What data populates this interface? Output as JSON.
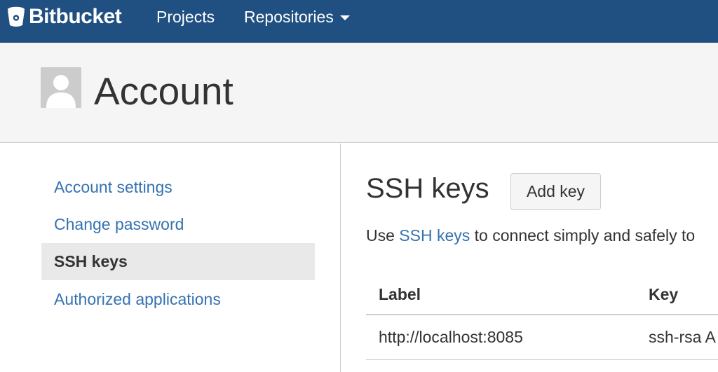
{
  "topbar": {
    "brand": "Bitbucket",
    "brand_icon": "bitbucket-bucket-icon",
    "nav": [
      {
        "label": "Projects"
      },
      {
        "label": "Repositories",
        "has_dropdown": true
      }
    ],
    "background_color": "#205081"
  },
  "header": {
    "title": "Account",
    "avatar_icon": "user-avatar-icon"
  },
  "sidebar": {
    "items": [
      {
        "label": "Account settings",
        "active": false
      },
      {
        "label": "Change password",
        "active": false
      },
      {
        "label": "SSH keys",
        "active": true
      },
      {
        "label": "Authorized applications",
        "active": false
      }
    ],
    "link_color": "#3572b0"
  },
  "main": {
    "title": "SSH keys",
    "add_button_label": "Add key",
    "intro": {
      "before": "Use ",
      "link": "SSH keys",
      "after": " to connect simply and safely to"
    },
    "table": {
      "columns": [
        "Label",
        "Key"
      ],
      "rows": [
        {
          "label": "http://localhost:8085",
          "key": "ssh-rsa A"
        }
      ]
    }
  }
}
